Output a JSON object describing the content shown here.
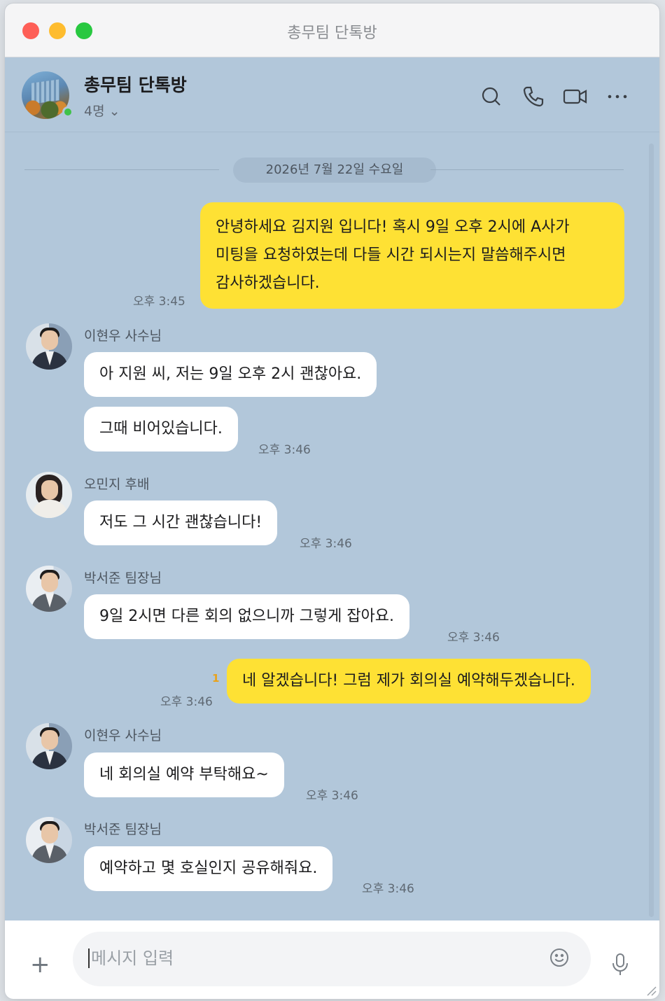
{
  "window": {
    "title": "총무팀 단톡방"
  },
  "header": {
    "room_name": "총무팀 단톡방",
    "member_count": "4명 ⌄"
  },
  "date_divider": "2026년 7월 22일 수요일",
  "messages": [
    {
      "lines": [
        "안녕하세요 김지원 입니다! 혹시 9일 오후 2시에 A사가",
        "미팅을 요청하였는데 다들 시간 되시는지 말씀해주시면",
        "감사하겠습니다."
      ],
      "time": "오후 3:45"
    },
    {
      "sender": "이현우 사수님",
      "text": "아 지원 씨, 저는 9일 오후 2시 괜찮아요."
    },
    {
      "text": "그때 비어있습니다.",
      "time": "오후 3:46"
    },
    {
      "sender": "오민지 후배",
      "text": "저도 그 시간 괜찮습니다!",
      "time": "오후 3:46"
    },
    {
      "sender": "박서준 팀장님",
      "text": "9일 2시면 다른 회의 없으니까 그렇게 잡아요.",
      "time": "오후 3:46"
    },
    {
      "text": "네 알겠습니다! 그럼 제가 회의실 예약해두겠습니다.",
      "time": "오후 3:46",
      "unread": "1"
    },
    {
      "sender": "이현우 사수님",
      "text": "네 회의실 예약 부탁해요~",
      "time": "오후 3:46"
    },
    {
      "sender": "박서준 팀장님",
      "text": "예약하고 몇 호실인지 공유해줘요.",
      "time": "오후 3:46"
    }
  ],
  "composer": {
    "placeholder": "메시지 입력",
    "plus": "+"
  }
}
